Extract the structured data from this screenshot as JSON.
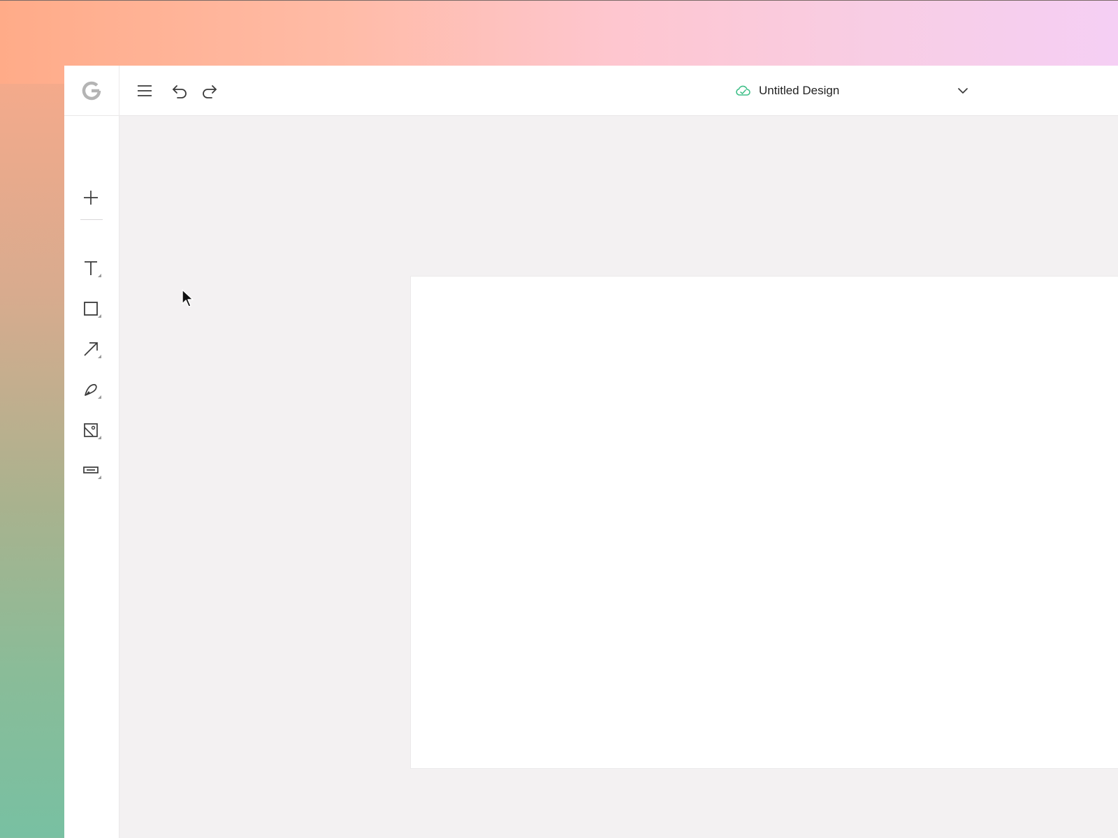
{
  "header": {
    "logo_icon": "app-logo-g-icon",
    "menu_icon": "hamburger-menu-icon",
    "undo_icon": "undo-icon",
    "redo_icon": "redo-icon",
    "sync_icon": "cloud-check-icon",
    "sync_color": "#3fbf88",
    "document_title": "Untitled Design",
    "dropdown_icon": "chevron-down-icon"
  },
  "toolbar": {
    "tools": [
      {
        "name": "add",
        "icon": "plus-icon"
      },
      {
        "name": "text",
        "icon": "text-tool-icon"
      },
      {
        "name": "rectangle",
        "icon": "rectangle-tool-icon"
      },
      {
        "name": "arrow",
        "icon": "arrow-tool-icon"
      },
      {
        "name": "pen",
        "icon": "pen-tool-icon"
      },
      {
        "name": "image",
        "icon": "image-tool-icon"
      },
      {
        "name": "component",
        "icon": "button-component-icon"
      }
    ]
  },
  "colors": {
    "canvas_bg": "#f3f1f2",
    "panel_bg": "#ffffff",
    "icon": "#3a3a3a"
  }
}
